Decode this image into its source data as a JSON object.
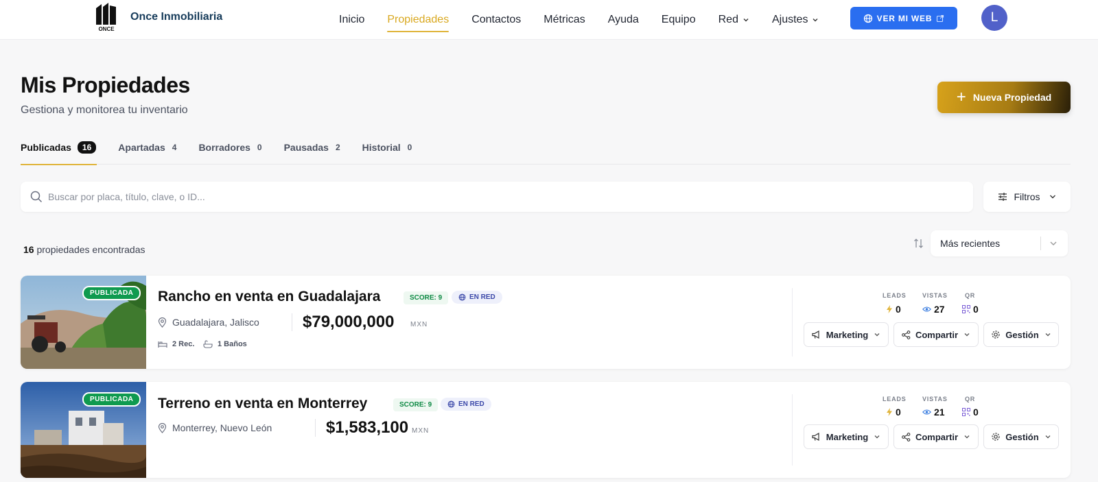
{
  "header": {
    "logo_text": "ONCE",
    "brand": "Once Inmobiliaria",
    "nav": [
      {
        "label": "Inicio"
      },
      {
        "label": "Propiedades"
      },
      {
        "label": "Contactos"
      },
      {
        "label": "Métricas"
      },
      {
        "label": "Ayuda"
      },
      {
        "label": "Equipo"
      },
      {
        "label": "Red"
      },
      {
        "label": "Ajustes"
      }
    ],
    "active_nav": "Propiedades",
    "web_button": "VER MI WEB",
    "avatar_initial": "L"
  },
  "page": {
    "title": "Mis Propiedades",
    "subtitle": "Gestiona y monitorea tu inventario",
    "new_button": "Nueva Propiedad"
  },
  "tabs": [
    {
      "label": "Publicadas",
      "count": "16"
    },
    {
      "label": "Apartadas",
      "count": "4"
    },
    {
      "label": "Borradores",
      "count": "0"
    },
    {
      "label": "Pausadas",
      "count": "2"
    },
    {
      "label": "Historial",
      "count": "0"
    }
  ],
  "search": {
    "placeholder": "Buscar por placa, título, clave, o ID...",
    "filters_label": "Filtros"
  },
  "results": {
    "count": "16",
    "text": "propiedades encontradas",
    "sort_label": "Más recientes"
  },
  "stat_labels": {
    "leads": "LEADS",
    "vistas": "VISTAS",
    "qr": "QR"
  },
  "actions": {
    "marketing": "Marketing",
    "compartir": "Compartir",
    "gestion": "Gestión"
  },
  "properties": [
    {
      "status": "PUBLICADA",
      "title": "Rancho en venta en Guadalajara",
      "score": "SCORE: 9",
      "network": "EN RED",
      "location": "Guadalajara, Jalisco",
      "price": "$79,000,000",
      "currency": "MXN",
      "rooms": "2 Rec.",
      "baths": "1 Baños",
      "leads": "0",
      "views": "27",
      "qr": "0"
    },
    {
      "status": "PUBLICADA",
      "title": "Terreno en venta en Monterrey",
      "score": "SCORE: 9",
      "network": "EN RED",
      "location": "Monterrey, Nuevo León",
      "price": "$1,583,100",
      "currency": "MXN",
      "leads": "0",
      "views": "21",
      "qr": "0"
    }
  ],
  "colors": {
    "accent_gold": "#e0b43a",
    "primary_blue": "#2a6ef0",
    "status_green": "#0f9a4f",
    "avatar": "#5161c9"
  }
}
